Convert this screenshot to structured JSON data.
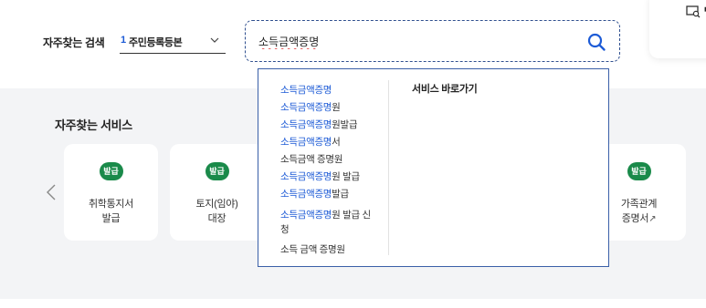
{
  "search": {
    "label": "자주찾는 검색",
    "select_rank": "1",
    "select_value": "주민등록등본",
    "input_value": "소득금액증명",
    "input_placeholder": ""
  },
  "corner": {
    "text": "ᄃ"
  },
  "services": {
    "title": "자주찾는 서비스",
    "badge_text": "발급",
    "cards": [
      {
        "line1": "취학통지서",
        "line2": "발급",
        "ext": ""
      },
      {
        "line1": "토지(임야)",
        "line2": "대장",
        "ext": ""
      },
      {
        "line1": "가족관계",
        "line2": "증명서",
        "ext": "↗"
      }
    ]
  },
  "autocomplete": {
    "right_title": "서비스 바로가기",
    "suggestions": [
      {
        "hl": "소득금액증명",
        "rest": ""
      },
      {
        "hl": "소득금액증명",
        "rest": "원"
      },
      {
        "hl": "소득금액증명",
        "rest": "원발급"
      },
      {
        "hl": "소득금액증명",
        "rest": "서"
      },
      {
        "hl": "",
        "rest": "소득금액 증명원"
      },
      {
        "hl": "소득금액증명",
        "rest": "원 발급"
      },
      {
        "hl": "소득금액증명",
        "rest": "발급"
      },
      {
        "hl": "소득금액증명",
        "rest": "원 발급 신"
      },
      {
        "hl": "",
        "rest": "청"
      },
      {
        "hl": "",
        "rest": "소득 금액 증명원"
      }
    ]
  },
  "colors": {
    "accent": "#1d5bd6",
    "badge": "#1a8a4a",
    "section_bg": "#f3f4f6"
  }
}
